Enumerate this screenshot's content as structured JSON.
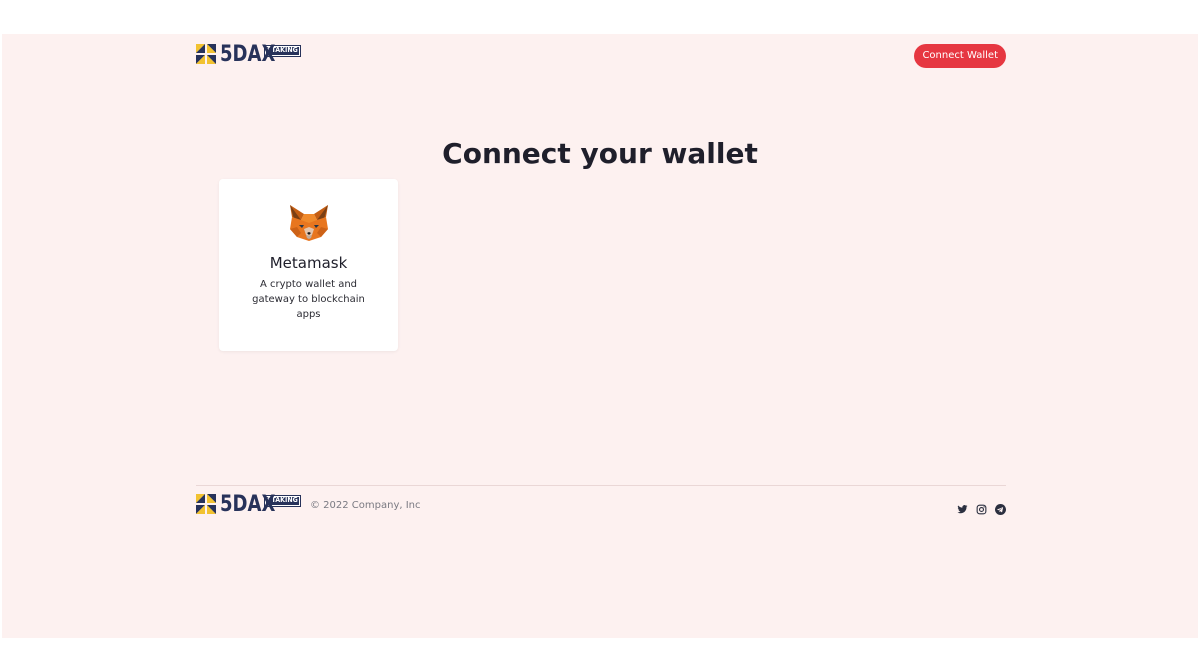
{
  "header": {
    "logo_text": "5DAX",
    "logo_tag": "STAKING",
    "connect_button": "Connect Wallet"
  },
  "main": {
    "title": "Connect your wallet",
    "wallets": [
      {
        "name": "Metamask",
        "description": "A crypto wallet and gateway to blockchain apps",
        "icon": "metamask-fox-icon"
      }
    ]
  },
  "footer": {
    "logo_text": "5DAX",
    "logo_tag": "STAKING",
    "copyright": "© 2022 Company, Inc",
    "social": [
      {
        "icon": "twitter-icon"
      },
      {
        "icon": "instagram-icon"
      },
      {
        "icon": "telegram-icon"
      }
    ]
  },
  "colors": {
    "background": "#fdf1f0",
    "accent": "#e63741",
    "brand_navy": "#27325a",
    "brand_yellow": "#f2c230"
  }
}
